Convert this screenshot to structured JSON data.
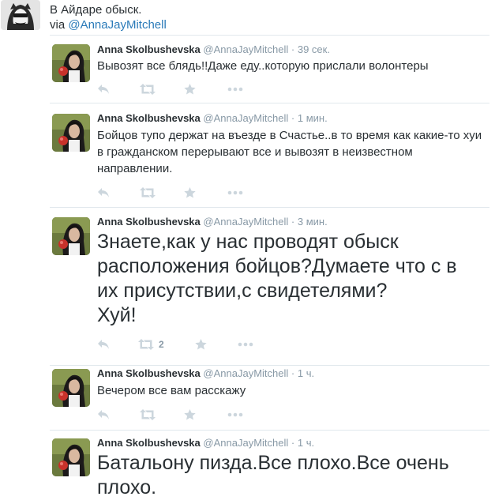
{
  "header": {
    "title": "В Айдаре обыск.",
    "via_prefix": "via ",
    "via_handle": "@AnnaJayMitchell"
  },
  "tweets": [
    {
      "name": "Anna Skolbushevska",
      "handle": "@AnnaJayMitchell",
      "dot": "·",
      "time": "39 сек.",
      "text": "Вывозят все блядь!!Даже еду..которую прислали волонтеры",
      "retweets": ""
    },
    {
      "name": "Anna Skolbushevska",
      "handle": "@AnnaJayMitchell",
      "dot": "·",
      "time": "1 мин.",
      "text": "Бойцов тупо держат на въезде в Счастье..в то время как какие-то хуи в гражданском перерывают все и вывозят в неизвестном направлении.",
      "retweets": ""
    },
    {
      "name": "Anna Skolbushevska",
      "handle": "@AnnaJayMitchell",
      "dot": "·",
      "time": "3 мин.",
      "text": "Знаете,как у нас проводят обыск расположения бойцов?Думаете что с в их присутствии,с свидетелями?\nХуй!",
      "retweets": "2"
    },
    {
      "name": "Anna Skolbushevska",
      "handle": "@AnnaJayMitchell",
      "dot": "·",
      "time": "1 ч.",
      "text": "Вечером все вам расскажу",
      "retweets": ""
    },
    {
      "name": "Anna Skolbushevska",
      "handle": "@AnnaJayMitchell",
      "dot": "·",
      "time": "1 ч.",
      "text": "Батальону пизда.Все плохо.Все очень плохо.",
      "retweets": ""
    }
  ],
  "icons": {
    "reply": "reply-icon",
    "retweet": "retweet-icon",
    "favorite": "star-icon",
    "more": "more-icon"
  },
  "colors": {
    "text": "#292f33",
    "meta": "#8899a6",
    "link": "#2b7bb9",
    "icon": "#ccd6dd",
    "divider": "#e1e8ed"
  }
}
